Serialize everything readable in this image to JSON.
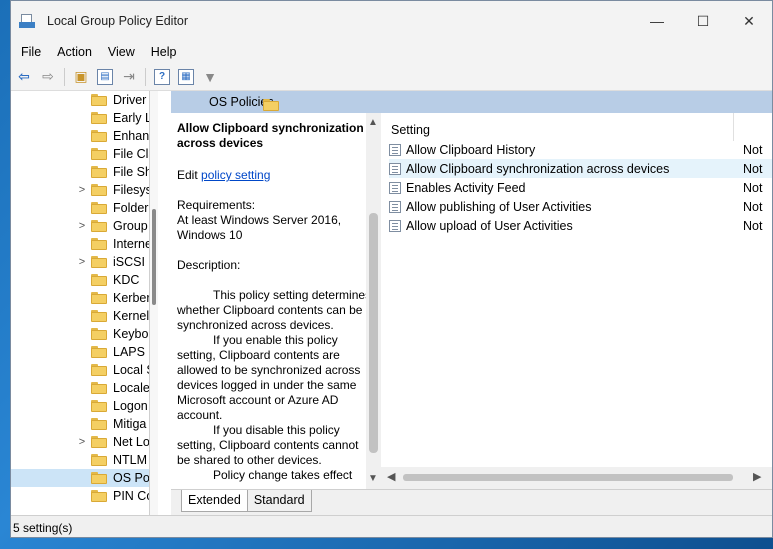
{
  "window": {
    "title": "Local Group Policy Editor"
  },
  "controls": {
    "minimize": "—",
    "maximize": "☐",
    "close": "✕"
  },
  "menu": [
    "File",
    "Action",
    "View",
    "Help"
  ],
  "toolbar": [
    "back-arrow",
    "forward-arrow",
    "up-folder",
    "show-hide-tree",
    "export-list",
    "help",
    "properties",
    "filter"
  ],
  "tree": {
    "items": [
      {
        "label": "Driver",
        "chevron": ""
      },
      {
        "label": "Early L",
        "chevron": ""
      },
      {
        "label": "Enhanc",
        "chevron": ""
      },
      {
        "label": "File Cla",
        "chevron": ""
      },
      {
        "label": "File Sh",
        "chevron": ""
      },
      {
        "label": "Filesys",
        "chevron": ">"
      },
      {
        "label": "Folder",
        "chevron": ""
      },
      {
        "label": "Group",
        "chevron": ">"
      },
      {
        "label": "Interne",
        "chevron": ""
      },
      {
        "label": "iSCSI",
        "chevron": ">"
      },
      {
        "label": "KDC",
        "chevron": ""
      },
      {
        "label": "Kerber",
        "chevron": ""
      },
      {
        "label": "Kernel",
        "chevron": ""
      },
      {
        "label": "Keybo",
        "chevron": ""
      },
      {
        "label": "LAPS",
        "chevron": ""
      },
      {
        "label": "Local S",
        "chevron": ""
      },
      {
        "label": "Locale",
        "chevron": ""
      },
      {
        "label": "Logon",
        "chevron": ""
      },
      {
        "label": "Mitiga",
        "chevron": ""
      },
      {
        "label": "Net Lo",
        "chevron": ">"
      },
      {
        "label": "NTLM",
        "chevron": ""
      },
      {
        "label": "OS Pol",
        "chevron": ""
      },
      {
        "label": "PIN Co",
        "chevron": ""
      }
    ]
  },
  "panel": {
    "header": "OS Policies"
  },
  "description": {
    "title": "Allow Clipboard synchronization across devices",
    "edit_prefix": "Edit ",
    "edit_link": "policy setting",
    "requirements_label": "Requirements:",
    "requirements": "At least Windows Server 2016, Windows 10",
    "description_label": "Description:",
    "paragraphs": [
      "This policy setting determines whether Clipboard contents can be synchronized across devices.",
      "If you enable this policy setting, Clipboard contents are allowed to be synchronized across devices logged in under the same Microsoft account or Azure AD account.",
      "If you disable this policy setting, Clipboard contents cannot be shared to other devices.",
      "Policy change takes effect"
    ]
  },
  "settings": {
    "header": "Setting",
    "state_header": "",
    "rows": [
      {
        "label": "Allow Clipboard History",
        "state": "Not"
      },
      {
        "label": "Allow Clipboard synchronization across devices",
        "state": "Not"
      },
      {
        "label": "Enables Activity Feed",
        "state": "Not"
      },
      {
        "label": "Allow publishing of User Activities",
        "state": "Not"
      },
      {
        "label": "Allow upload of User Activities",
        "state": "Not"
      }
    ]
  },
  "tabs": [
    "Extended",
    "Standard"
  ],
  "status": "5 setting(s)"
}
